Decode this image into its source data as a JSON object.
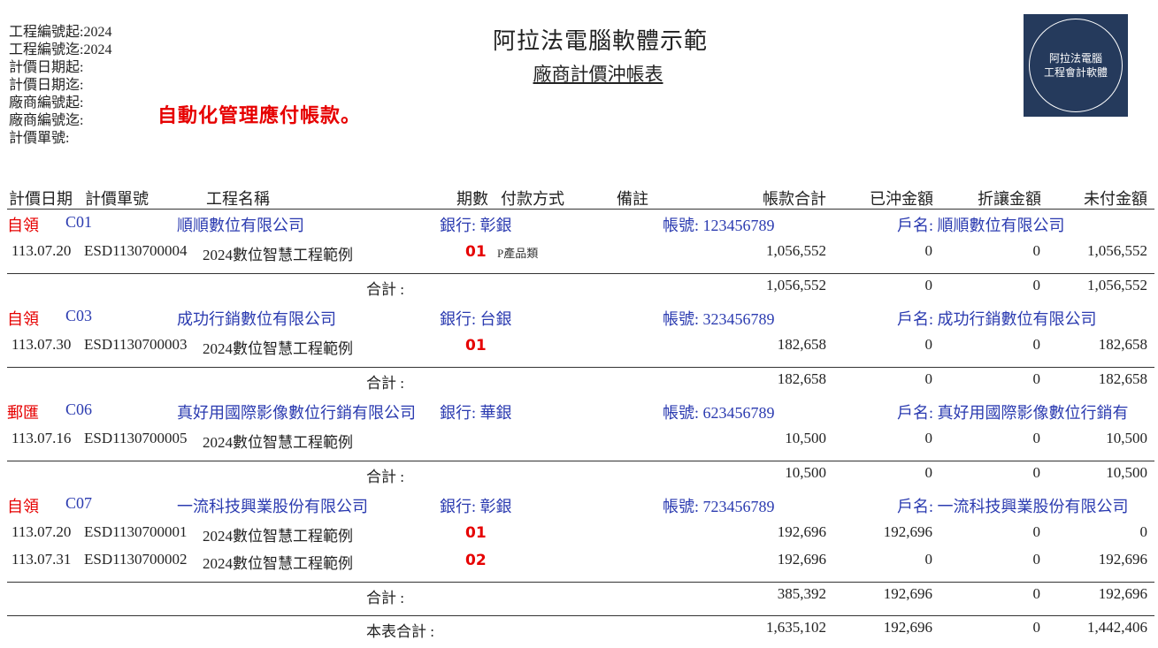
{
  "header": {
    "filters": [
      "工程編號起:2024",
      "工程編號迄:2024",
      "計價日期起:",
      "計價日期迄:",
      "廠商編號起:",
      "廠商編號迄:",
      "計價單號:"
    ],
    "company_title": "阿拉法電腦軟體示範",
    "report_title": "廠商計價沖帳表",
    "slogan": "自動化管理應付帳款。",
    "logo_lines": [
      "阿拉法電腦",
      "工程會計軟體"
    ]
  },
  "columns": {
    "date": "計價日期",
    "no": "計價單號",
    "project": "工程名稱",
    "period": "期數",
    "pay_method": "付款方式",
    "remark": "備註",
    "total": "帳款合計",
    "offset": "已沖金額",
    "discount": "折讓金額",
    "unpaid": "未付金額"
  },
  "groups": [
    {
      "method": "自領",
      "code": "C01",
      "name": "順順數位有限公司",
      "bank": "銀行: 彰銀",
      "account": "帳號: 123456789",
      "holder": "戶名: 順順數位有限公司",
      "rows": [
        {
          "date": "113.07.20",
          "no": "ESD1130700004",
          "project": "2024數位智慧工程範例",
          "period": "01",
          "remark": "P產品類",
          "total": "1,056,552",
          "offset": "0",
          "discount": "0",
          "unpaid": "1,056,552"
        }
      ],
      "subtotal_label": "合計 :",
      "subtotal": {
        "total": "1,056,552",
        "offset": "0",
        "discount": "0",
        "unpaid": "1,056,552"
      }
    },
    {
      "method": "自領",
      "code": "C03",
      "name": "成功行銷數位有限公司",
      "bank": "銀行: 台銀",
      "account": "帳號: 323456789",
      "holder": "戶名: 成功行銷數位有限公司",
      "rows": [
        {
          "date": "113.07.30",
          "no": "ESD1130700003",
          "project": "2024數位智慧工程範例",
          "period": "01",
          "remark": "",
          "total": "182,658",
          "offset": "0",
          "discount": "0",
          "unpaid": "182,658"
        }
      ],
      "subtotal_label": "合計 :",
      "subtotal": {
        "total": "182,658",
        "offset": "0",
        "discount": "0",
        "unpaid": "182,658"
      }
    },
    {
      "method": "郵匯",
      "code": "C06",
      "name": "真好用國際影像數位行銷有限公司",
      "bank": "銀行: 華銀",
      "account": "帳號: 623456789",
      "holder": "戶名: 真好用國際影像數位行銷有",
      "rows": [
        {
          "date": "113.07.16",
          "no": "ESD1130700005",
          "project": "2024數位智慧工程範例",
          "period": "",
          "remark": "",
          "total": "10,500",
          "offset": "0",
          "discount": "0",
          "unpaid": "10,500"
        }
      ],
      "subtotal_label": "合計 :",
      "subtotal": {
        "total": "10,500",
        "offset": "0",
        "discount": "0",
        "unpaid": "10,500"
      }
    },
    {
      "method": "自領",
      "code": "C07",
      "name": "一流科技興業股份有限公司",
      "bank": "銀行: 彰銀",
      "account": "帳號: 723456789",
      "holder": "戶名: 一流科技興業股份有限公司",
      "rows": [
        {
          "date": "113.07.20",
          "no": "ESD1130700001",
          "project": "2024數位智慧工程範例",
          "period": "01",
          "remark": "",
          "total": "192,696",
          "offset": "192,696",
          "discount": "0",
          "unpaid": "0"
        },
        {
          "date": "113.07.31",
          "no": "ESD1130700002",
          "project": "2024數位智慧工程範例",
          "period": "02",
          "remark": "",
          "total": "192,696",
          "offset": "0",
          "discount": "0",
          "unpaid": "192,696"
        }
      ],
      "subtotal_label": "合計 :",
      "subtotal": {
        "total": "385,392",
        "offset": "192,696",
        "discount": "0",
        "unpaid": "192,696"
      }
    }
  ],
  "grand_total": {
    "label": "本表合計 :",
    "total": "1,635,102",
    "offset": "192,696",
    "discount": "0",
    "unpaid": "1,442,406"
  },
  "colors": {
    "vendor_text": "#2b3bb0",
    "accent_red": "#e60000",
    "logo_bg": "#253a5c"
  }
}
